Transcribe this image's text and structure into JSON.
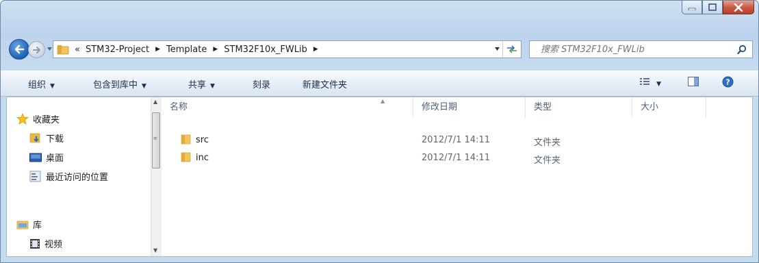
{
  "window": {
    "caption": {
      "minimize": "minimize",
      "maximize": "maximize",
      "close": "close"
    }
  },
  "address": {
    "overflow": "«",
    "crumbs": [
      "STM32-Project",
      "Template",
      "STM32F10x_FWLib"
    ]
  },
  "search": {
    "placeholder": "搜索 STM32F10x_FWLib"
  },
  "toolbar": {
    "organize": "组织",
    "include_library": "包含到库中",
    "share": "共享",
    "burn": "刻录",
    "new_folder": "新建文件夹"
  },
  "nav": {
    "favorites": "收藏夹",
    "downloads": "下载",
    "desktop": "桌面",
    "recent": "最近访问的位置",
    "libraries": "库",
    "videos": "视频"
  },
  "columns": {
    "name": "名称",
    "date": "修改日期",
    "type": "类型",
    "size": "大小"
  },
  "files": [
    {
      "name": "src",
      "date": "2012/7/1 14:11",
      "type": "文件夹",
      "size": ""
    },
    {
      "name": "inc",
      "date": "2012/7/1 14:11",
      "type": "文件夹",
      "size": ""
    }
  ],
  "colors": {
    "accent": "#2d6bb3",
    "folder": "#e8b84a",
    "close": "#c95a45"
  }
}
